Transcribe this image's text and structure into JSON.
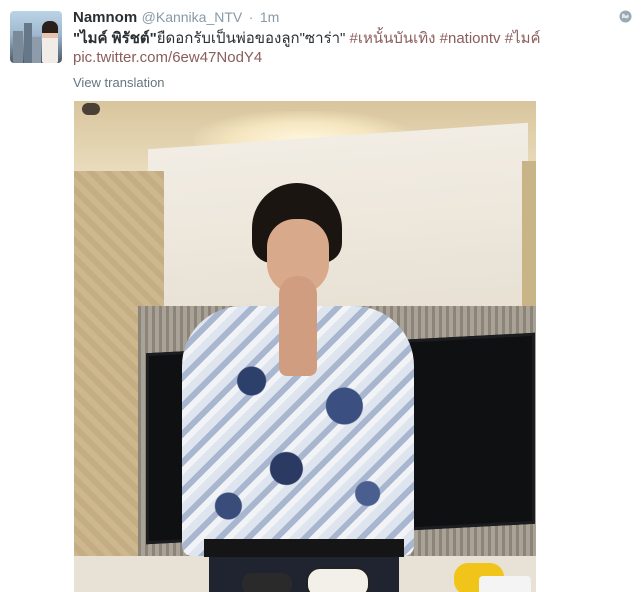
{
  "tweet": {
    "author_name": "Namnom",
    "handle": "@Kannika_NTV",
    "separator": "·",
    "time": "1m",
    "text_bold": "\"ไมค์ พิรัชต์\"",
    "text_body": "ยืดอกรับเป็นพ่อของลูก\"ซาร่า\" ",
    "hashtags": [
      "#เหนั้นบันเทิง",
      "#nationtv",
      "#ไมค์"
    ],
    "link": "pic.twitter.com/6ew47NodY4",
    "translate_label": "View translation"
  },
  "icons": {
    "globe": "globe-icon",
    "avatar": "avatar"
  },
  "colors": {
    "link": "#8b5c5c",
    "meta": "#8899a6",
    "text": "#292f33"
  }
}
